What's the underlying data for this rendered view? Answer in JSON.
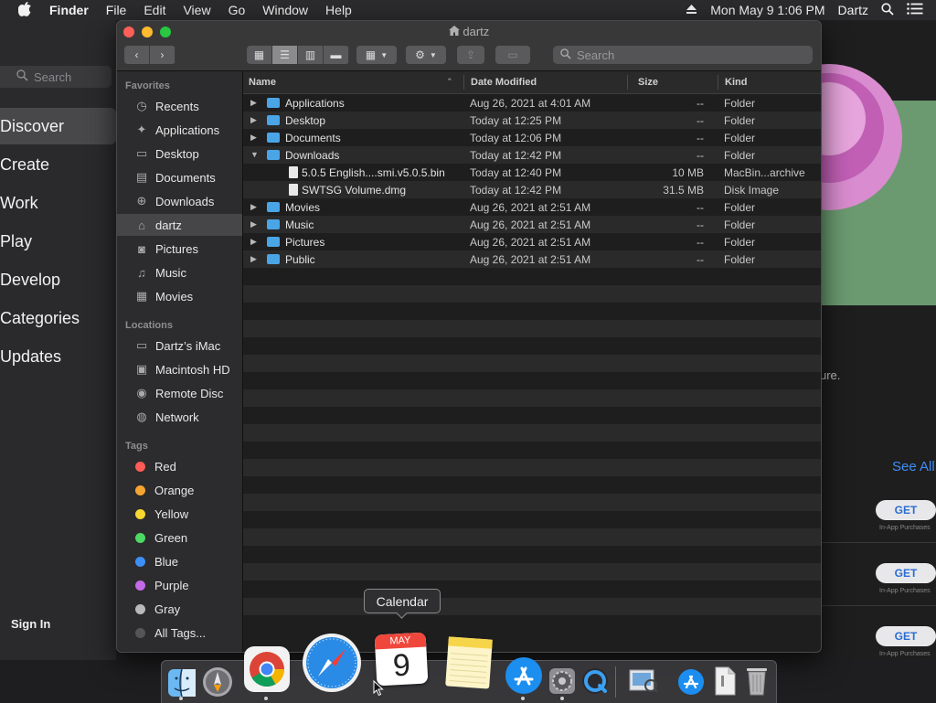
{
  "menubar": {
    "app": "Finder",
    "items": [
      "File",
      "Edit",
      "View",
      "Go",
      "Window",
      "Help"
    ],
    "clock": "Mon May 9  1:06 PM",
    "user": "Dartz"
  },
  "appstore": {
    "search_placeholder": "Search",
    "nav": [
      "Discover",
      "Create",
      "Work",
      "Play",
      "Develop",
      "Categories",
      "Updates"
    ],
    "sign_in": "Sign In",
    "partial_text": "ure.",
    "see_all": "See All",
    "get_label": "GET",
    "iap_label": "In-App Purchases"
  },
  "finder": {
    "title": "dartz",
    "search_placeholder": "Search",
    "sidebar": {
      "favorites_header": "Favorites",
      "favorites": [
        {
          "label": "Recents",
          "icon": "clock-icon"
        },
        {
          "label": "Applications",
          "icon": "applications-icon"
        },
        {
          "label": "Desktop",
          "icon": "desktop-icon"
        },
        {
          "label": "Documents",
          "icon": "documents-icon"
        },
        {
          "label": "Downloads",
          "icon": "downloads-icon"
        },
        {
          "label": "dartz",
          "icon": "home-icon"
        },
        {
          "label": "Pictures",
          "icon": "camera-icon"
        },
        {
          "label": "Music",
          "icon": "music-icon"
        },
        {
          "label": "Movies",
          "icon": "film-icon"
        }
      ],
      "locations_header": "Locations",
      "locations": [
        {
          "label": "Dartz’s iMac",
          "icon": "imac-icon"
        },
        {
          "label": "Macintosh HD",
          "icon": "disk-icon"
        },
        {
          "label": "Remote Disc",
          "icon": "disc-icon"
        },
        {
          "label": "Network",
          "icon": "globe-icon"
        }
      ],
      "tags_header": "Tags",
      "tags": [
        {
          "label": "Red",
          "color": "#ff5b57"
        },
        {
          "label": "Orange",
          "color": "#f7a531"
        },
        {
          "label": "Yellow",
          "color": "#f7d82f"
        },
        {
          "label": "Green",
          "color": "#4cd964"
        },
        {
          "label": "Blue",
          "color": "#3d8ff7"
        },
        {
          "label": "Purple",
          "color": "#c26ae8"
        },
        {
          "label": "Gray",
          "color": "#b9b9bb"
        },
        {
          "label": "All Tags...",
          "color": "#555557"
        }
      ]
    },
    "columns": {
      "name": "Name",
      "date": "Date Modified",
      "size": "Size",
      "kind": "Kind"
    },
    "rows": [
      {
        "name": "Applications",
        "date": "Aug 26, 2021 at 4:01 AM",
        "size": "--",
        "kind": "Folder",
        "type": "folder",
        "expanded": false,
        "indent": 0
      },
      {
        "name": "Desktop",
        "date": "Today at 12:25 PM",
        "size": "--",
        "kind": "Folder",
        "type": "folder",
        "expanded": false,
        "indent": 0
      },
      {
        "name": "Documents",
        "date": "Today at 12:06 PM",
        "size": "--",
        "kind": "Folder",
        "type": "folder",
        "expanded": false,
        "indent": 0
      },
      {
        "name": "Downloads",
        "date": "Today at 12:42 PM",
        "size": "--",
        "kind": "Folder",
        "type": "folder",
        "expanded": true,
        "indent": 0
      },
      {
        "name": "5.0.5 English....smi.v5.0.5.bin",
        "date": "Today at 12:40 PM",
        "size": "10 MB",
        "kind": "MacBin...archive",
        "type": "file",
        "expanded": false,
        "indent": 1
      },
      {
        "name": "SWTSG Volume.dmg",
        "date": "Today at 12:42 PM",
        "size": "31.5 MB",
        "kind": "Disk Image",
        "type": "file",
        "expanded": false,
        "indent": 1
      },
      {
        "name": "Movies",
        "date": "Aug 26, 2021 at 2:51 AM",
        "size": "--",
        "kind": "Folder",
        "type": "folder",
        "expanded": false,
        "indent": 0
      },
      {
        "name": "Music",
        "date": "Aug 26, 2021 at 2:51 AM",
        "size": "--",
        "kind": "Folder",
        "type": "folder",
        "expanded": false,
        "indent": 0
      },
      {
        "name": "Pictures",
        "date": "Aug 26, 2021 at 2:51 AM",
        "size": "--",
        "kind": "Folder",
        "type": "folder",
        "expanded": false,
        "indent": 0
      },
      {
        "name": "Public",
        "date": "Aug 26, 2021 at 2:51 AM",
        "size": "--",
        "kind": "Folder",
        "type": "folder",
        "expanded": false,
        "indent": 0
      }
    ]
  },
  "dock": {
    "tooltip": "Calendar",
    "calendar_month": "MAY",
    "calendar_day": "9",
    "apps": [
      "finder-icon",
      "launchpad-icon",
      "chrome-icon",
      "safari-icon",
      "calendar-icon",
      "notes-icon",
      "app-store-icon",
      "system-preferences-icon",
      "quicktime-icon",
      "preview-icon",
      "app-store-folder-icon",
      "document-icon",
      "trash-icon"
    ]
  }
}
